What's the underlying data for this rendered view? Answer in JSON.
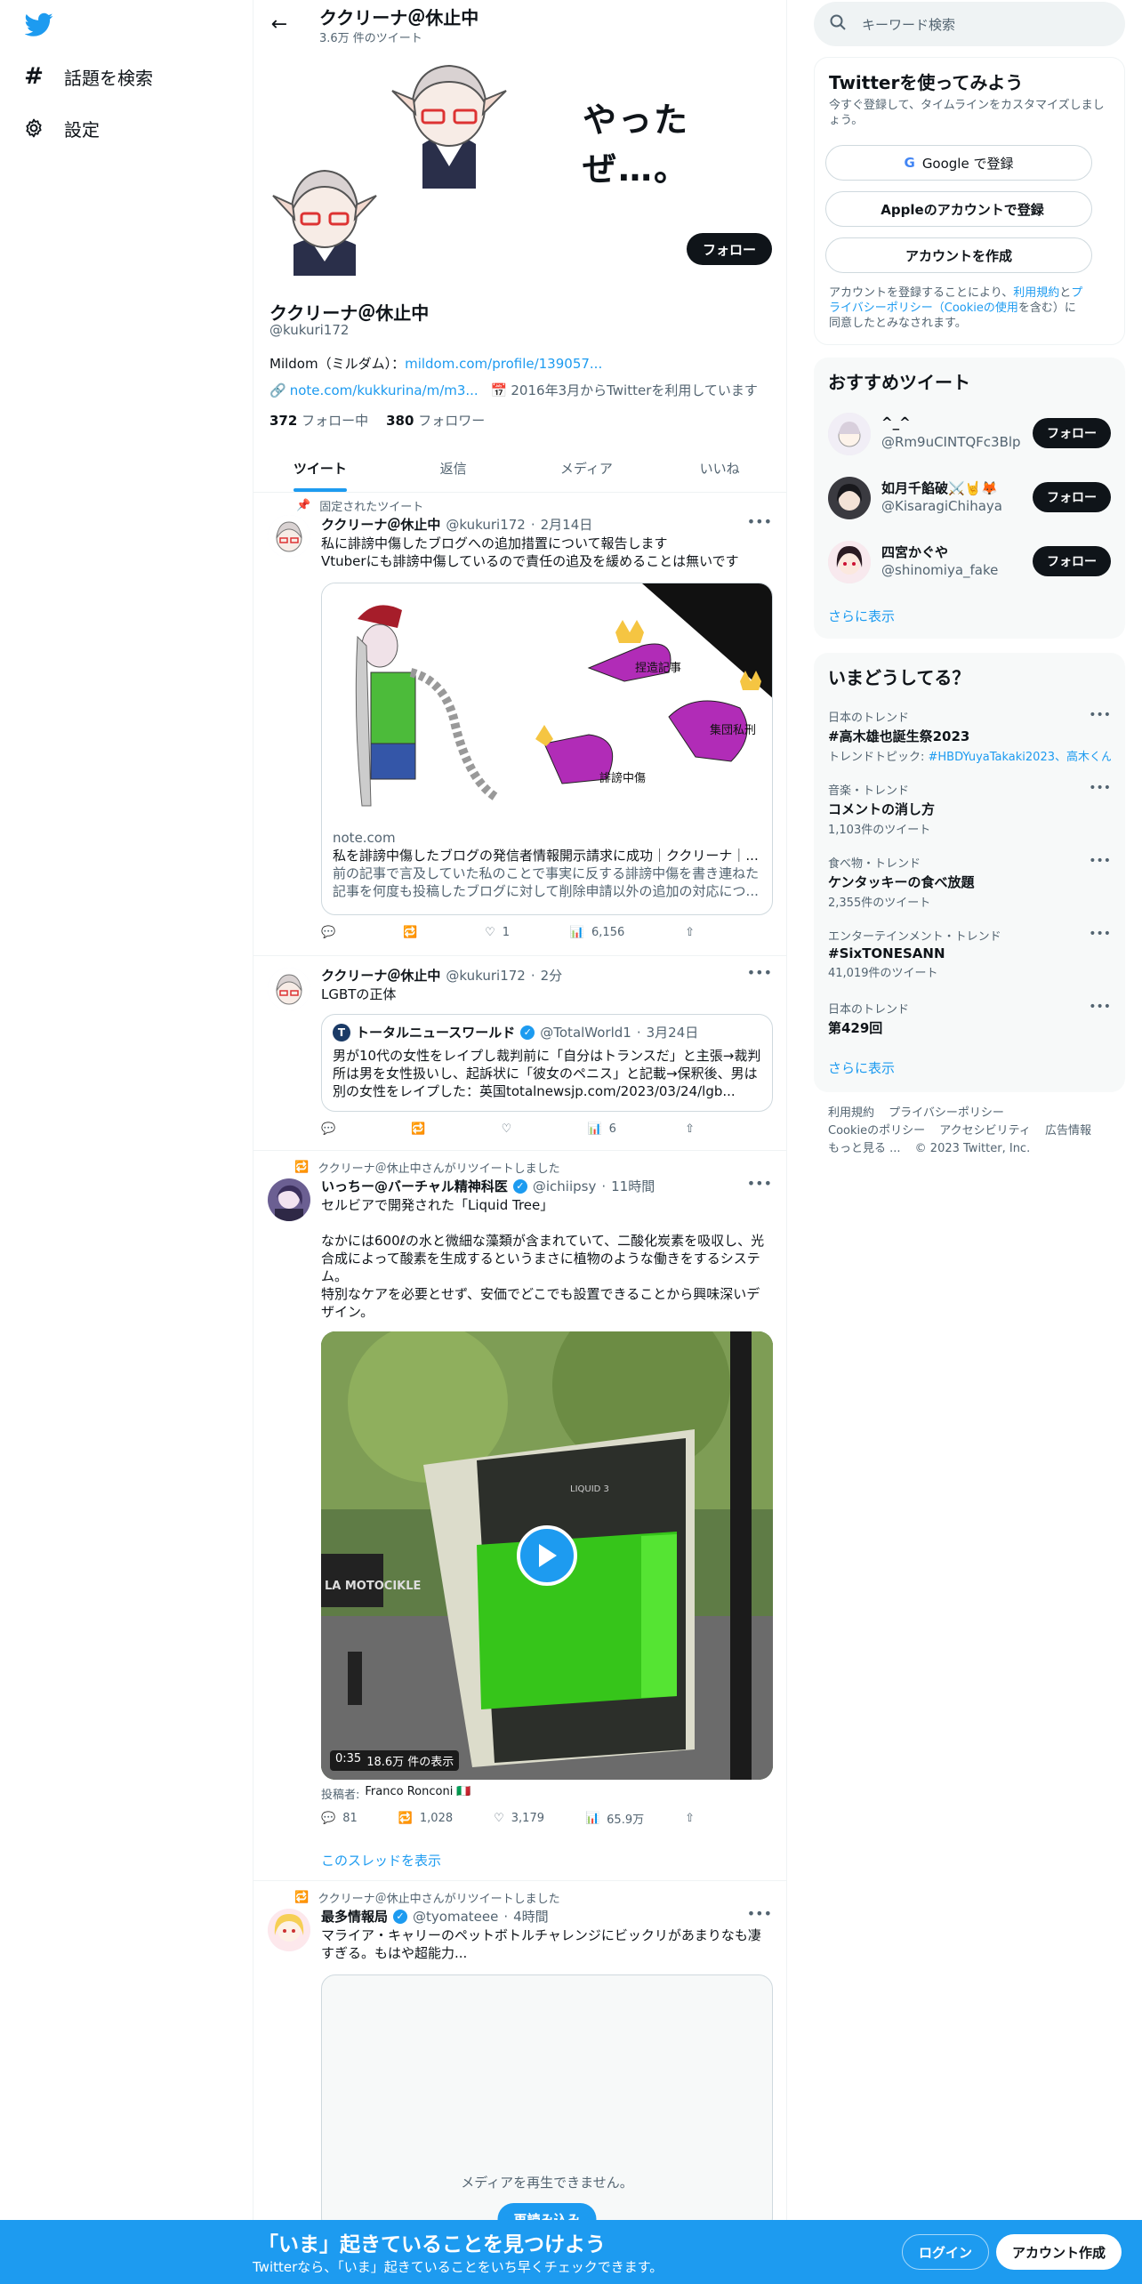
{
  "nav": {
    "explore_label": "話題を検索",
    "settings_label": "設定"
  },
  "header": {
    "title": "ククリーナ＠休止中",
    "subtitle": "3.6万 件のツイート"
  },
  "banner": {
    "text": "やったぜ…。"
  },
  "profile": {
    "follow_label": "フォロー",
    "name": "ククリーナ＠休止中",
    "handle": "@kukuri172",
    "bio_prefix": "Mildom（ミルダム）：",
    "bio_link": "mildom.com/profile/139057...",
    "website": "note.com/kukkurina/m/m3...",
    "joined": "2016年3月からTwitterを利用しています",
    "following_count": "372",
    "following_label": "フォロー中",
    "followers_count": "380",
    "followers_label": "フォロワー"
  },
  "tabs": [
    "ツイート",
    "返信",
    "メディア",
    "いいね"
  ],
  "tweets": [
    {
      "context": "固定されたツイート",
      "name": "ククリーナ＠休止中",
      "handle": "@kukuri172",
      "time": "2月14日",
      "text": "私に誹謗中傷したブログへの追加措置について報告します\nVtuberにも誹謗中傷しているので責任の追及を緩めることは無いです",
      "card": {
        "labels": [
          "捏造記事",
          "集団私刑",
          "誹謗中傷"
        ],
        "domain": "note.com",
        "title": "私を誹謗中傷したブログの発信者情報開示請求に成功｜ククリーナ｜...",
        "desc": "前の記事で言及していた私のことで事実に反する誹謗中傷を書き連ねた記事を何度も投稿したブログに対して削除申請以外の追加の対応につ..."
      },
      "replies": "",
      "retweets": "",
      "likes": "1",
      "views": "6,156"
    },
    {
      "name": "ククリーナ＠休止中",
      "handle": "@kukuri172",
      "time": "2分",
      "text": "LGBTの正体",
      "quote": {
        "name": "トータルニュースワールド",
        "handle": "@TotalWorld1",
        "time": "3月24日",
        "text": "男が10代の女性をレイプし裁判前に「自分はトランスだ」と主張→裁判所は男を女性扱いし、起訴状に「彼女のペニス」と記載→保釈後、男は別の女性をレイプした：英国totalnewsjp.com/2023/03/24/lgb..."
      },
      "replies": "",
      "retweets": "",
      "likes": "",
      "views": "6"
    },
    {
      "context": "ククリーナ＠休止中さんがリツイートしました",
      "name": "いっちー@バーチャル精神科医",
      "handle": "@ichiipsy",
      "time": "11時間",
      "text": "セルビアで開発された「Liquid Tree」\n\nなかには600ℓの水と微細な藻類が含まれていて、二酸化炭素を吸収し、光合成によって酸素を生成するというまさに植物のような働きをするシステム。\n特別なケアを必要とせず、安価でどこでも設置できることから興味深いデザイン。",
      "video": {
        "duration": "0:35",
        "views": "18.6万 件の表示",
        "sign": "LIQUID 3",
        "sign_left": "LA MOTOCIKLE"
      },
      "poster_label": "投稿者:",
      "poster": "Franco Ronconi 🇮🇹",
      "replies": "81",
      "retweets": "1,028",
      "likes": "3,179",
      "views": "65.9万",
      "show_thread": "このスレッドを表示"
    },
    {
      "context": "ククリーナ＠休止中さんがリツイートしました",
      "name": "最多情報局",
      "handle": "@tyomateee",
      "time": "4時間",
      "text": "マライア・キャリーのペットボトルチャレンジにビックリがあまりなも凄すぎる。もはや超能力...",
      "media_error": "メディアを再生できません。",
      "reload": "再読み込み"
    }
  ],
  "right": {
    "search_placeholder": "キーワード検索",
    "signup": {
      "title": "Twitterを使ってみよう",
      "desc": "今すぐ登録して、タイムラインをカスタマイズしましょう。",
      "google": "Google で登録",
      "apple": "Appleのアカウントで登録",
      "create": "アカウントを作成",
      "legal_1": "アカウントを登録することにより、",
      "legal_terms": "利用規約",
      "legal_2": "と",
      "legal_privacy": "プライバシーポリシー（Cookieの使用",
      "legal_3": "を含む）に同意したとみなされます。"
    },
    "recommended": {
      "title": "おすすめツイート",
      "users": [
        {
          "name": "^_^",
          "handle": "@Rm9uCINTQFc3Blp",
          "follow": "フォロー"
        },
        {
          "name": "如月千餡破⚔️🤘🦊",
          "handle": "@KisaragiChihaya",
          "follow": "フォロー"
        },
        {
          "name": "四宮かぐや",
          "handle": "@shinomiya_fake",
          "follow": "フォロー"
        }
      ],
      "more": "さらに表示"
    },
    "trends": {
      "title": "いまどうしてる？",
      "items": [
        {
          "category": "日本のトレンド",
          "name": "#高木雄也誕生祭2023",
          "meta_prefix": "トレンドトピック: ",
          "meta_link": "#HBDYuyaTakaki2023、高木くん"
        },
        {
          "category": "音楽・トレンド",
          "name": "コメントの消し方",
          "meta": "1,103件のツイート"
        },
        {
          "category": "食べ物・トレンド",
          "name": "ケンタッキーの食べ放題",
          "meta": "2,355件のツイート"
        },
        {
          "category": "エンターテインメント・トレンド",
          "name": "#SixTONESANN",
          "meta": "41,019件のツイート"
        },
        {
          "category": "日本のトレンド",
          "name": "第429回",
          "meta": ""
        }
      ],
      "more": "さらに表示"
    },
    "footer": [
      "利用規約",
      "プライバシーポリシー",
      "Cookieのポリシー",
      "アクセシビリティ",
      "広告情報",
      "もっと見る ...",
      "© 2023 Twitter, Inc."
    ]
  },
  "bottombar": {
    "title": "「いま」起きていることを見つけよう",
    "subtitle": "Twitterなら、「いま」起きていることをいち早くチェックできます。",
    "login": "ログイン",
    "signup": "アカウント作成"
  },
  "colors": {
    "accent": "#1d9bf0",
    "text": "#0f1419",
    "muted": "#536471"
  }
}
